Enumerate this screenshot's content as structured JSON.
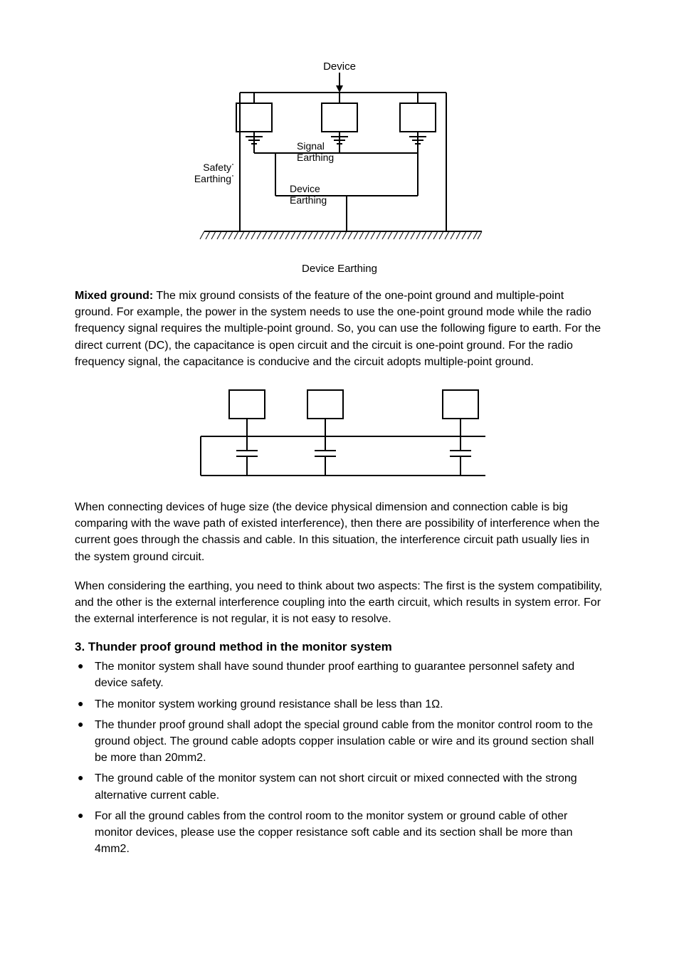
{
  "figure1": {
    "device_label": "Device",
    "safety_label_line1": "Safety",
    "safety_label_line2": "Earthing",
    "signal_label_line1": "Signal",
    "signal_label_line2": "Earthing",
    "device_earthing_label_line1": "Device",
    "device_earthing_label_line2": "Earthing",
    "caption": "Device Earthing"
  },
  "para1": {
    "lead": "Mixed ground:",
    "rest": " The mix ground consists of the feature of the one-point ground and multiple-point ground. For example, the power in the system needs to use the one-point ground mode while the radio frequency signal requires the multiple-point ground.  So, you can use the following figure to earth. For the direct current (DC), the capacitance is open circuit and the circuit is one-point ground. For the radio frequency signal, the capacitance is conducive and the circuit adopts multiple-point ground."
  },
  "para2": "When connecting devices of huge size (the device physical dimension and connection cable is big comparing with the wave path of existed interference), then there are possibility of interference when the current goes through the chassis and cable. In this situation, the interference circuit path usually lies in the system ground circuit.",
  "para3": "When considering the earthing, you need to think about two aspects: The first is the system compatibility, and the other is the external interference coupling into the earth circuit, which results in system error. For the external interference is not regular, it is not easy to resolve.",
  "section3": {
    "title": "3. Thunder proof ground method in the monitor system",
    "bullets": [
      "The monitor system shall have sound thunder proof earthing to guarantee personnel safety and device safety.",
      "The monitor system working ground resistance shall be less than 1Ω.",
      "The thunder proof ground shall adopt the special ground cable from the monitor control room to the ground object. The ground cable adopts copper insulation cable or wire and its ground section shall be more than 20mm2.",
      "The ground cable of the monitor system can not short circuit or mixed connected with the strong alternative current cable.",
      "For all the ground cables from the control room to the monitor system or ground cable of other monitor devices, please use the copper resistance soft cable and its section shall be more than 4mm2."
    ]
  }
}
